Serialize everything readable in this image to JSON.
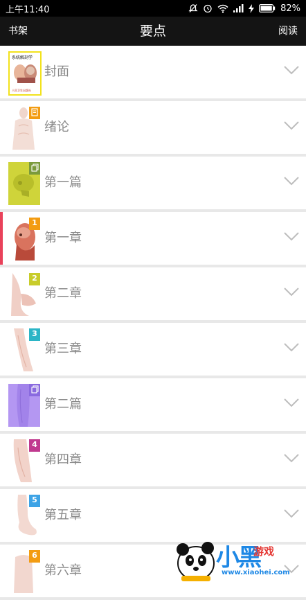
{
  "status_bar": {
    "time": "上午11:40",
    "battery": "82%",
    "icons": [
      "mute-icon",
      "alarm-icon",
      "wifi-icon",
      "signal-icon",
      "charging-icon",
      "battery-icon"
    ]
  },
  "nav": {
    "left": "书架",
    "title": "要点",
    "right": "阅读"
  },
  "cover": {
    "title": "系统解剖学",
    "publisher": "人民卫生出版社"
  },
  "items": [
    {
      "label": "封面",
      "badge": "",
      "badge_color": ""
    },
    {
      "label": "绪论",
      "badge": "doc",
      "badge_color": "#f39c12"
    },
    {
      "label": "第一篇",
      "badge": "copy",
      "badge_color": "#7a9a3c"
    },
    {
      "label": "第一章",
      "badge": "1",
      "badge_color": "#f39c12"
    },
    {
      "label": "第二章",
      "badge": "2",
      "badge_color": "#c8cc2a"
    },
    {
      "label": "第三章",
      "badge": "3",
      "badge_color": "#2bb5c6"
    },
    {
      "label": "第二篇",
      "badge": "copy",
      "badge_color": "#8a6adf"
    },
    {
      "label": "第四章",
      "badge": "4",
      "badge_color": "#c0398f"
    },
    {
      "label": "第五章",
      "badge": "5",
      "badge_color": "#3da3e6"
    },
    {
      "label": "第六章",
      "badge": "6",
      "badge_color": "#f39c12"
    }
  ],
  "watermark": {
    "brand": "小黑",
    "sub": "游戏",
    "url": "www.xiaohei.com"
  }
}
